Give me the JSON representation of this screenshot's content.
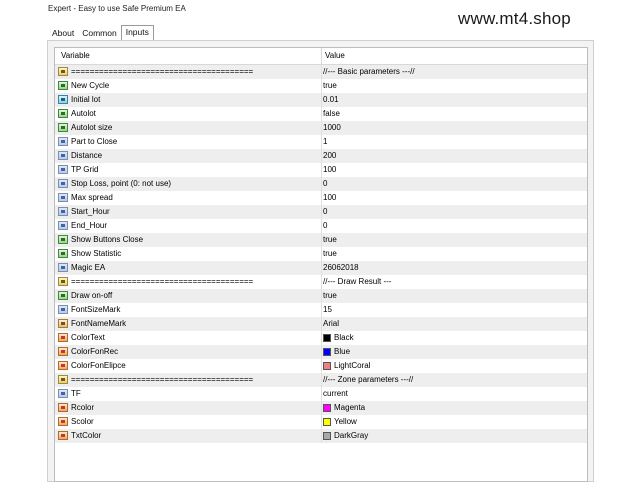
{
  "window": {
    "title": "Expert - Easy to use Safe Premium EA"
  },
  "watermark": "www.mt4.shop",
  "tabs": [
    {
      "label": "About",
      "active": false
    },
    {
      "label": "Common",
      "active": false
    },
    {
      "label": "Inputs",
      "active": true
    }
  ],
  "table": {
    "headers": {
      "variable": "Variable",
      "value": "Value"
    },
    "rows": [
      {
        "name": "=======================================",
        "value": "//--- Basic parameters ---//",
        "type": "sep"
      },
      {
        "name": "New Cycle",
        "value": "true",
        "type": "bool"
      },
      {
        "name": "Initial lot",
        "value": "0.01",
        "type": "dbl"
      },
      {
        "name": "Autolot",
        "value": "false",
        "type": "bool"
      },
      {
        "name": "Autolot size",
        "value": "1000",
        "type": "bool"
      },
      {
        "name": "Part to Close",
        "value": "1",
        "type": "int"
      },
      {
        "name": "Distance",
        "value": "200",
        "type": "int"
      },
      {
        "name": "TP Grid",
        "value": "100",
        "type": "int"
      },
      {
        "name": "Stop Loss, point (0: not use)",
        "value": "0",
        "type": "int"
      },
      {
        "name": "Max spread",
        "value": "100",
        "type": "int"
      },
      {
        "name": "Start_Hour",
        "value": "0",
        "type": "int"
      },
      {
        "name": "End_Hour",
        "value": "0",
        "type": "int"
      },
      {
        "name": "Show Buttons Close",
        "value": "true",
        "type": "bool"
      },
      {
        "name": "Show Statistic",
        "value": "true",
        "type": "bool"
      },
      {
        "name": "Magic EA",
        "value": "26062018",
        "type": "int"
      },
      {
        "name": "=======================================",
        "value": "//--- Draw Result ---",
        "type": "sep"
      },
      {
        "name": "Draw on-off",
        "value": "true",
        "type": "bool"
      },
      {
        "name": "FontSizeMark",
        "value": "15",
        "type": "int"
      },
      {
        "name": "FontNameMark",
        "value": "Arial",
        "type": "str"
      },
      {
        "name": "ColorText",
        "value": "Black",
        "type": "col",
        "swatch": "#000000"
      },
      {
        "name": "ColorFonRec",
        "value": "Blue",
        "type": "col",
        "swatch": "#0000ff"
      },
      {
        "name": "ColorFonElipce",
        "value": "LightCoral",
        "type": "col",
        "swatch": "#f08080"
      },
      {
        "name": "=======================================",
        "value": "//--- Zone parameters ---//",
        "type": "sep"
      },
      {
        "name": "TF",
        "value": "current",
        "type": "int"
      },
      {
        "name": "Rcolor",
        "value": "Magenta",
        "type": "col",
        "swatch": "#ff00ff"
      },
      {
        "name": "Scolor",
        "value": "Yellow",
        "type": "col",
        "swatch": "#ffff00"
      },
      {
        "name": "TxtColor",
        "value": "DarkGray",
        "type": "col",
        "swatch": "#a9a9a9"
      }
    ]
  }
}
